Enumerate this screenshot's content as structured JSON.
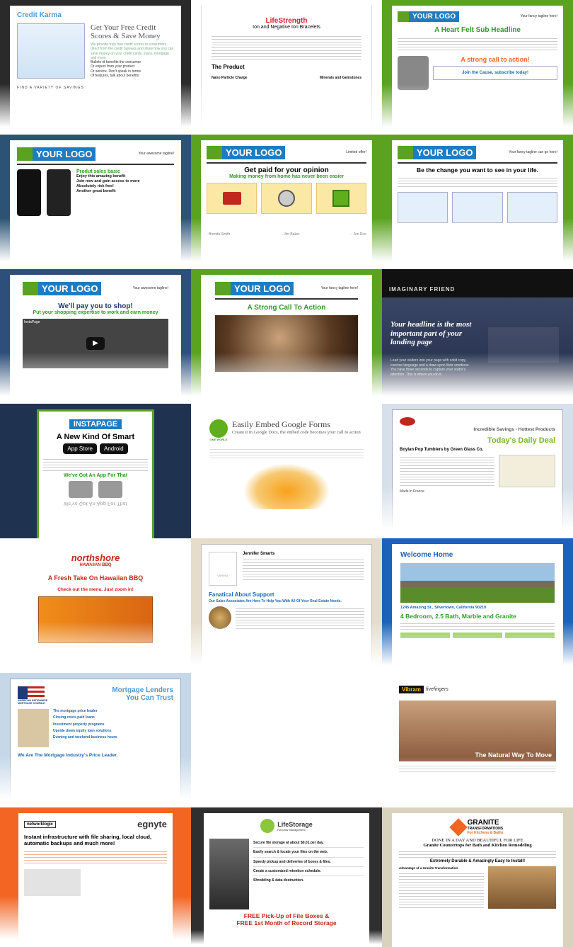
{
  "tiles": [
    {
      "id": "creditkarma",
      "logo": "Credit Karma",
      "title": "Get Your Free Credit Scores & Save Money",
      "body": "We provide truly free credit scores to consumers direct from the credit bureaus and show how you can save money on your credit cards, loans, mortgage and more.",
      "bullets": [
        "Bullets of benefits the consumer",
        "Or expect from your product",
        "Or service. Don't speak in terms",
        "Of features, talk about benefits."
      ],
      "footer": "FIND A VARIETY OF SAVINGS"
    },
    {
      "id": "lifestrength",
      "title": "LifeStrength",
      "subtitle": "Ion and Negative Ion Bracelets",
      "section": "The Product",
      "item1": "Nano Particle Charge",
      "item2": "Minerals and Gemstones"
    },
    {
      "id": "heartfelt",
      "logo": "YOUR LOGO",
      "tagline": "Your fancy tagline here!",
      "title": "A Heart Felt Sub Headline",
      "cta": "A strong call to action!",
      "join": "Join the Cause, subscribe today!"
    },
    {
      "id": "phone",
      "logo": "YOUR LOGO",
      "tagline": "Your awesome tagline!",
      "heading": "Produt sales basic",
      "bullets": [
        "Enjoy this amazing benefit",
        "Join now and gain access to more",
        "Absolutely risk free!",
        "Another great benefit"
      ]
    },
    {
      "id": "paid",
      "logo": "YOUR LOGO",
      "tagline": "Limited offer!",
      "title": "Get paid for your opinion",
      "subtitle": "Making money from home has never been easier",
      "names": [
        "- Brenda Smith",
        "- Jim Baker",
        "- Jon Doe"
      ]
    },
    {
      "id": "change",
      "logo": "YOUR LOGO",
      "tagline": "Your fancy tagline can go here!",
      "title": "Be the change you want to see in your life."
    },
    {
      "id": "shop",
      "logo": "YOUR LOGO",
      "tagline": "Your awesome tagline!",
      "title": "We'll pay you to shop!",
      "subtitle": "Put your shopping expertise to work and earn money",
      "video": "InstaPage"
    },
    {
      "id": "strongcta",
      "logo": "YOUR LOGO",
      "tagline": "Your fancy tagline here!",
      "title": "A Strong Call To Action"
    },
    {
      "id": "imaginary",
      "brand": "IMAGINARY FRIEND",
      "headline": "Your headline is the most important part of your landing page",
      "body": "Lead your visitors into your page with solid copy, concise language and a draw upon their emotions. You have three seconds to capture your visitor's attention. This is where you do it."
    },
    {
      "id": "instapage",
      "logo": "INSTAPAGE",
      "title": "A New Kind Of Smart",
      "appstore": "App Store",
      "android": "Android",
      "sub": "We've Got An App For That",
      "reflect": "We've Got An App For That"
    },
    {
      "id": "google",
      "logo": "ONE WORLD",
      "title": "Easily Embed Google Forms",
      "subtitle": "Create it in Google Docs, the embed code becomes your call to action"
    },
    {
      "id": "deal",
      "header": "Incredible Savings - Hottest Products",
      "title": "Today's Daily Deal",
      "product": "Boylan Pop Tumblers by Green Glass Co.",
      "origin": "Made in France"
    },
    {
      "id": "northshore",
      "logo": "northshore",
      "logo2": "HAWAIIAN BBQ",
      "title": "A Fresh Take On Hawaiian BBQ",
      "sub": "Check out the menu. Just zoom in!"
    },
    {
      "id": "realtor",
      "name": "Jennifer Smarts",
      "brand": "VARINIA",
      "title": "Fanatical About Support",
      "sub": "Our Sales Associates Are Here To Help You With All Of Your Real Estate Needs."
    },
    {
      "id": "home",
      "title": "Welcome Home",
      "address": "1245 Amazing St., Silvertown, California 90210",
      "headline": "4 Bedroom, 2.5 Bath, Marble and Granite"
    },
    {
      "id": "mortgage",
      "logo": "AMERICAN NATIONWIDE MORTGAGE COMPANY",
      "title1": "Mortgage Lenders",
      "title2": "You Can Trust",
      "bullets": [
        "The mortgage price leader",
        "Closing costs paid loans",
        "Investment property programs",
        "Upside down equity loan solutions",
        "Evening and weekend business hours"
      ],
      "bar": "We Are The Mortgage Industry's Price Leader."
    },
    {
      "id": "vibram",
      "logo": "Vibram",
      "logo2": "fivefingers",
      "caption": "The Natural Way To Move"
    },
    {
      "id": "egnyte",
      "logo": "egnyte",
      "partner": "networklogic",
      "title": "Instant infrastructure with file sharing, local cloud, automatic backups and much more!"
    },
    {
      "id": "lifestorage",
      "logo": "LifeStorage",
      "logo2": "Records Management",
      "bullets": [
        "Secure file storage at about $0.01 per day.",
        "Easily search & locate your files on the web.",
        "Speedy pickup and deliveries of boxes & files.",
        "Create a customized retention schedule.",
        "Shredding & data destruction."
      ],
      "offer1": "FREE Pick-Up of File Boxes &",
      "offer2": "FREE 1st Month of Record Storage"
    },
    {
      "id": "granite",
      "logo": "GRANITE",
      "logo2": "TRANSFORMATIONS",
      "logo3": "For Kitchens & Baths",
      "title1": "DONE IN A DAY AND BEAUTIFUL FOR LIFE",
      "title2": "Granite Countertops for Bath and Kitchen Remodeling",
      "sub": "Extremely Durable & Amazingly Easy to Install!",
      "adv": "Advantage of a Granite Transformation"
    }
  ],
  "colors": {
    "green": "#5aa21f",
    "blue": "#1f7cc1",
    "orange": "#f26522"
  }
}
